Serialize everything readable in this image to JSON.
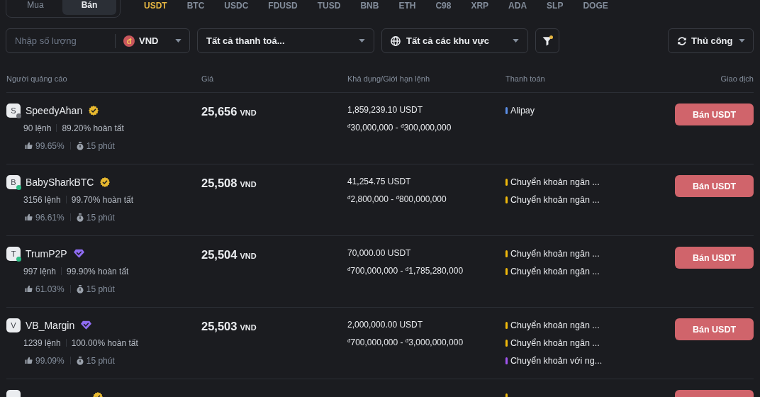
{
  "trade_side": [
    {
      "label": "Mua",
      "selected": false
    },
    {
      "label": "Bán",
      "selected": true
    }
  ],
  "assets": [
    {
      "label": "USDT",
      "selected": true
    },
    {
      "label": "BTC",
      "selected": false
    },
    {
      "label": "USDC",
      "selected": false
    },
    {
      "label": "FDUSD",
      "selected": false
    },
    {
      "label": "TUSD",
      "selected": false
    },
    {
      "label": "BNB",
      "selected": false
    },
    {
      "label": "ETH",
      "selected": false
    },
    {
      "label": "C98",
      "selected": false
    },
    {
      "label": "XRP",
      "selected": false
    },
    {
      "label": "ADA",
      "selected": false
    },
    {
      "label": "SLP",
      "selected": false
    },
    {
      "label": "DOGE",
      "selected": false
    }
  ],
  "filters": {
    "amount": {
      "placeholder": "Nhập số lượng",
      "currency_symbol": "đ",
      "currency": "VND"
    },
    "payment": {
      "value": "Tất cả thanh toá..."
    },
    "region": {
      "value": "Tất cả các khu vực"
    },
    "filter_button": {
      "active": true
    },
    "refresh": {
      "value": "Thủ công"
    }
  },
  "table": {
    "columns": [
      "Người quảng cáo",
      "Giá",
      "Khả dụng/Giới hạn lệnh",
      "Thanh toán",
      "Giao dịch"
    ],
    "rows": [
      {
        "avatar": "S",
        "status_dot": {
          "color": "#6b6e75"
        },
        "name": "SpeedyAhan",
        "badge": {
          "kind": "seal"
        },
        "orders": "90 lệnh",
        "completion": "89.20% hoàn tất",
        "rating": "99.65%",
        "time": "15 phút",
        "price": "25,656",
        "price_unit": "VND",
        "available": "1,859,239.10 USDT",
        "limit": "$^{đ}$30,000,000 - $^{đ}$300,000,000",
        "payments": [
          {
            "label": "Alipay",
            "color": "#5b8ee6"
          }
        ],
        "action": "Bán USDT"
      },
      {
        "avatar": "B",
        "status_dot": {
          "color": "#2ebd85"
        },
        "name": "BabySharkBTC",
        "badge": {
          "kind": "seal"
        },
        "orders": "3156 lệnh",
        "completion": "99.70% hoàn tất",
        "rating": "96.61%",
        "time": "15 phút",
        "price": "25,508",
        "price_unit": "VND",
        "available": "41,254.75 USDT",
        "limit": "$^{đ}$2,800,000 - $^{đ}$800,000,000",
        "payments": [
          {
            "label": "Chuyển khoản ngân ...",
            "color": "#f0b90b"
          },
          {
            "label": "Chuyển khoản ngân ...",
            "color": "#f0b90b"
          }
        ],
        "action": "Bán USDT"
      },
      {
        "avatar": "T",
        "status_dot": {
          "color": "#2ebd85"
        },
        "name": "TrumP2P",
        "badge": {
          "kind": "diamond"
        },
        "orders": "997 lệnh",
        "completion": "99.90% hoàn tất",
        "rating": "61.03%",
        "time": "15 phút",
        "price": "25,504",
        "price_unit": "VND",
        "available": "70,000.00 USDT",
        "limit": "$^{đ}$700,000,000 - $^{đ}$1,785,280,000",
        "payments": [
          {
            "label": "Chuyển khoản ngân ...",
            "color": "#f0b90b"
          },
          {
            "label": "Chuyển khoản ngân ...",
            "color": "#f0b90b"
          }
        ],
        "action": "Bán USDT"
      },
      {
        "avatar": "V",
        "name": "VB_Margin",
        "badge": {
          "kind": "diamond"
        },
        "orders": "1239 lệnh",
        "completion": "100.00% hoàn tất",
        "rating": "99.09%",
        "time": "15 phút",
        "price": "25,503",
        "price_unit": "VND",
        "available": "2,000,000.00 USDT",
        "limit": "$^{đ}$700,000,000 - $^{đ}$3,000,000,000",
        "payments": [
          {
            "label": "Chuyển khoản ngân ...",
            "color": "#f0b90b"
          },
          {
            "label": "Chuyển khoản ngân ...",
            "color": "#f0b90b"
          },
          {
            "label": "Chuyển khoản với ng...",
            "color": "#a155f0"
          }
        ],
        "action": "Bán USDT"
      },
      {
        "badge": {
          "kind": "seal"
        },
        "payments": [
          {
            "color": "#f0b90b"
          }
        ],
        "sell_button": true
      }
    ]
  }
}
